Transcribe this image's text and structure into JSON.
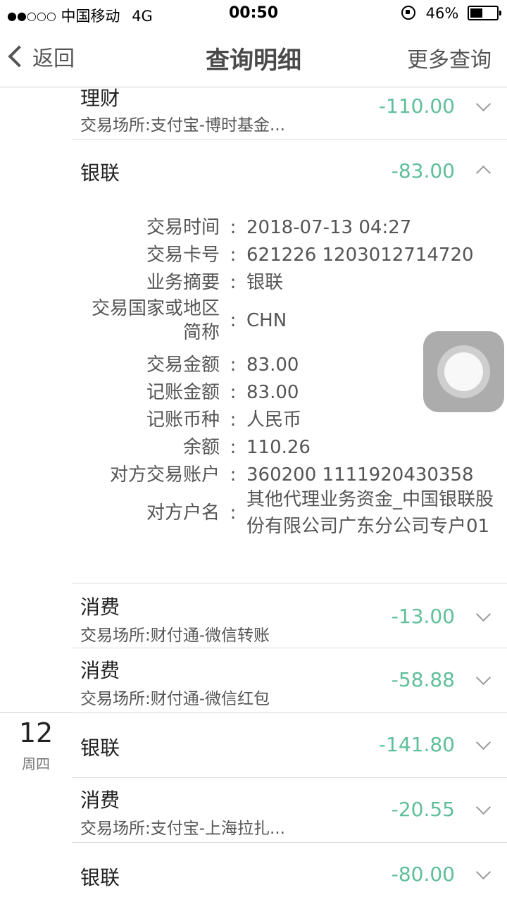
{
  "status_bar": {
    "signal": "●●○○○",
    "carrier": "中国移动",
    "network": "4G",
    "time": "00:50",
    "battery": "46%",
    "battery_level": 0.46
  },
  "nav": {
    "back_label": "返回",
    "title": "查询明细",
    "more_label": "更多查询"
  },
  "transactions": [
    {
      "title": "理财",
      "subtitle": "交易场所:支付宝-博时基金...",
      "amount": "-110.00"
    },
    {
      "title": "银联",
      "amount": "-83.00"
    },
    {
      "title": "消费",
      "subtitle": "交易场所:财付通-微信转账",
      "amount": "-13.00"
    },
    {
      "title": "消费",
      "subtitle": "交易场所:财付通-微信红包",
      "amount": "-58.88"
    },
    {
      "title": "银联",
      "amount": "-141.80"
    },
    {
      "title": "消费",
      "subtitle": "交易场所:支付宝-上海拉扎...",
      "amount": "-20.55"
    },
    {
      "title": "银联",
      "amount": "-80.00"
    }
  ],
  "details": [
    {
      "label": "交易时间",
      "value": "2018-07-13 04:27"
    },
    {
      "label": "交易卡号",
      "value": "621226 1203012714720"
    },
    {
      "label": "业务摘要",
      "value": "银联"
    },
    {
      "label": "交易国家或地区简称",
      "value": "CHN"
    },
    {
      "label": "交易金额",
      "value": "83.00"
    },
    {
      "label": "记账金额",
      "value": "83.00"
    },
    {
      "label": "记账币种",
      "value": "人民币"
    },
    {
      "label": "余额",
      "value": "110.26"
    },
    {
      "label": "对方交易账户",
      "value": "360200 1111920430358"
    },
    {
      "label": "对方户名",
      "value": "其他代理业务资金_中国银联股份有限公司广东分公司专户01"
    }
  ],
  "detail_colon": ":",
  "date_group": {
    "day": "12",
    "weekday": "周四"
  },
  "colors": {
    "amount": "#5fbf9a",
    "text": "#222222",
    "divider": "#dcdcdc"
  }
}
